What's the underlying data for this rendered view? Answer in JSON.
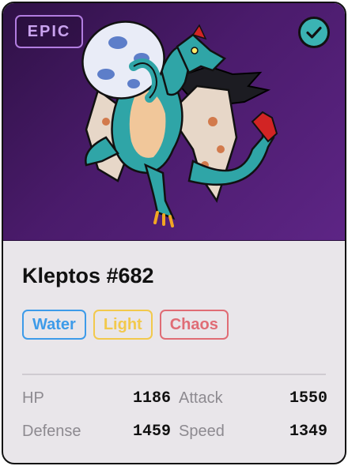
{
  "card": {
    "rarity": "EPIC",
    "selected_icon": "check-icon",
    "name": "Kleptos #682",
    "creature_icon": "dragon-holding-egg-artwork"
  },
  "tags": [
    {
      "label": "Water",
      "color": "#3d9be9"
    },
    {
      "label": "Light",
      "color": "#f2c94c"
    },
    {
      "label": "Chaos",
      "color": "#e06c75"
    }
  ],
  "stats": {
    "hp": {
      "label": "HP",
      "value": "1186"
    },
    "attack": {
      "label": "Attack",
      "value": "1550"
    },
    "defense": {
      "label": "Defense",
      "value": "1459"
    },
    "speed": {
      "label": "Speed",
      "value": "1349"
    }
  }
}
